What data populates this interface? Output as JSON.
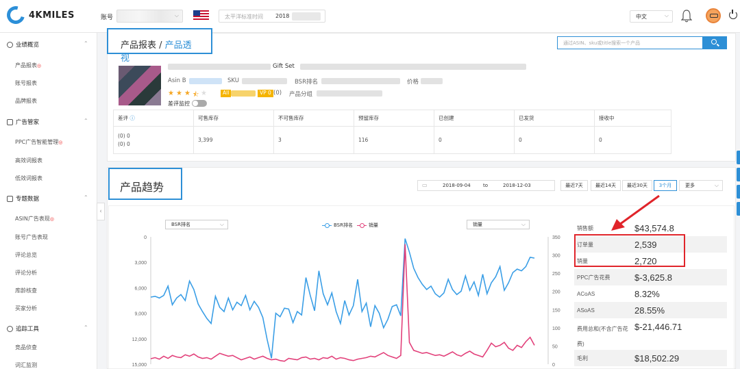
{
  "header": {
    "logo_text": "4KMILES",
    "account_label": "账号",
    "timezone_text": "太平洋标准时间",
    "year": "2018",
    "language": "中文"
  },
  "sidebar": {
    "sections": [
      {
        "label": "业绩概览",
        "items": [
          {
            "label": "产品报表",
            "badge": "◎"
          },
          {
            "label": "账号报表"
          },
          {
            "label": "品牌报表"
          }
        ]
      },
      {
        "label": "广告管家",
        "items": [
          {
            "label": "PPC广告智能管理",
            "badge": "◎"
          },
          {
            "label": "高效词报表"
          },
          {
            "label": "低效词报表"
          }
        ]
      },
      {
        "label": "专题数据",
        "items": [
          {
            "label": "ASIN广告表现",
            "badge": "◎"
          },
          {
            "label": "账号广告表现"
          },
          {
            "label": "评论总览"
          },
          {
            "label": "评论分析"
          },
          {
            "label": "库龄核查"
          },
          {
            "label": "买家分析"
          }
        ]
      },
      {
        "label": "追踪工具",
        "items": [
          {
            "label": "竞品侦查"
          },
          {
            "label": "词汇监测"
          }
        ]
      }
    ]
  },
  "product": {
    "breadcrumb_parent": "产品报表 / ",
    "breadcrumb_current": "产品透视",
    "search_placeholder": "通过ASIN、sku或title搜索一个产品",
    "title_suffix": "Gift Set",
    "asin_label": "Asin B",
    "sku_label": "SKU",
    "bsr_label": "BSR排名",
    "price_label": "价格",
    "tag_all": "All",
    "tag_vp": "VP 0",
    "vp_count": "(0)",
    "group_label": "产品分组",
    "monitor_label": "差评监控",
    "rating_stars": 3.5
  },
  "inventory": {
    "headers": [
      "差评",
      "可售库存",
      "不可售库存",
      "预留库存",
      "已创建",
      "已发货",
      "接收中"
    ],
    "values": [
      "(0) 0\n(0) 0",
      "3,399",
      "3",
      "116",
      "0",
      "0",
      "0"
    ]
  },
  "trend": {
    "title": "产品趋势",
    "date_start": "2018-09-04",
    "date_to": "to",
    "date_end": "2018-12-03",
    "ranges": [
      "最近7天",
      "最近14天",
      "最近30天",
      "3个月"
    ],
    "active_range": "3个月",
    "more_label": "更多",
    "left_select": "BSR排名",
    "right_select": "销量",
    "legend_bsr": "BSR排名",
    "legend_sales": "销量",
    "left_axis_ticks": [
      "0",
      "3,000",
      "6,000",
      "9,000",
      "12,000",
      "15,000"
    ],
    "right_axis_ticks": [
      "350",
      "300",
      "250",
      "200",
      "150",
      "100",
      "50",
      "0"
    ]
  },
  "metrics": [
    {
      "label": "销售额",
      "value": "$43,574.8"
    },
    {
      "label": "订单量",
      "value": "2,539"
    },
    {
      "label": "销量",
      "value": "2,720"
    },
    {
      "label": "PPC广告花费",
      "value": "$-3,625.8"
    },
    {
      "label": "ACoAS",
      "value": "8.32%"
    },
    {
      "label": "ASoAS",
      "value": "28.55%"
    },
    {
      "label": "费用总和(不含广告花费)",
      "value": "$-21,446.71"
    },
    {
      "label": "毛利",
      "value": "$18,502.29"
    }
  ],
  "chart_data": {
    "type": "line",
    "x_count": 90,
    "series": [
      {
        "name": "BSR排名",
        "axis": "left",
        "color": "#3a9ee6",
        "values": [
          7100,
          7000,
          7200,
          6900,
          5800,
          8000,
          7200,
          6800,
          7500,
          5200,
          6200,
          7900,
          8800,
          9600,
          10200,
          7000,
          8300,
          8800,
          7200,
          8600,
          7700,
          8100,
          6900,
          8600,
          7600,
          8300,
          9500,
          12100,
          14300,
          9000,
          9400,
          8400,
          8500,
          10100,
          8800,
          9200,
          4800,
          6900,
          8700,
          4000,
          6700,
          8000,
          6600,
          8800,
          10200,
          7500,
          9200,
          8100,
          5000,
          8800,
          7800,
          10600,
          8100,
          9000,
          10700,
          9700,
          8200,
          8000,
          9300,
          200,
          1800,
          3700,
          4800,
          5600,
          6200,
          5800,
          6700,
          7100,
          6600,
          5000,
          6200,
          6800,
          6400,
          4600,
          6300,
          5300,
          6900,
          4400,
          6700,
          5400,
          4700,
          3500,
          6300,
          5400,
          4200,
          3800,
          4000,
          3500,
          2400,
          2500
        ]
      },
      {
        "name": "销量",
        "axis": "right",
        "color": "#e2407a",
        "values": [
          15,
          18,
          14,
          22,
          16,
          24,
          20,
          18,
          26,
          22,
          28,
          20,
          16,
          18,
          14,
          22,
          30,
          26,
          22,
          24,
          18,
          12,
          16,
          20,
          14,
          18,
          22,
          16,
          12,
          14,
          10,
          8,
          16,
          14,
          12,
          18,
          20,
          14,
          16,
          12,
          18,
          16,
          22,
          14,
          18,
          16,
          12,
          10,
          14,
          16,
          18,
          22,
          20,
          26,
          32,
          24,
          20,
          16,
          24,
          330,
          60,
          38,
          34,
          30,
          32,
          28,
          24,
          26,
          22,
          28,
          34,
          26,
          22,
          30,
          36,
          28,
          24,
          20,
          38,
          58,
          48,
          52,
          60,
          44,
          38,
          52,
          46,
          62,
          74,
          52
        ]
      }
    ],
    "left_ylim": [
      15000,
      0
    ],
    "right_ylim": [
      0,
      350
    ],
    "grid": false,
    "legend_position": "top-center"
  }
}
